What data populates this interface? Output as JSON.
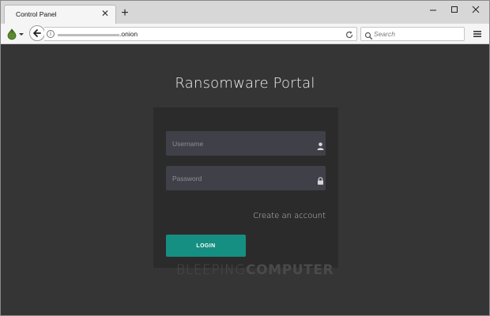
{
  "browser": {
    "tab": {
      "title": "Control Panel",
      "close_glyph": "✕"
    },
    "new_tab_glyph": "+",
    "url": {
      "visible_text": ".onion",
      "info_glyph": "i"
    },
    "search": {
      "placeholder": "Search"
    },
    "icons": {
      "onion": "onion-icon",
      "back": "back-arrow-icon",
      "reload": "reload-icon",
      "search": "search-icon",
      "menu": "hamburger-menu-icon",
      "minimize": "minimize-icon",
      "maximize": "maximize-icon",
      "close": "close-icon"
    }
  },
  "page": {
    "title": "Ransomware Portal",
    "form": {
      "username_placeholder": "Username",
      "password_placeholder": "Password",
      "create_account": "Create an account",
      "login_label": "LOGIN"
    },
    "watermark": {
      "part1": "BLEEPING",
      "part2": "COMPUTER"
    }
  },
  "colors": {
    "page_bg": "#353535",
    "card_bg": "#2b2b2b",
    "field_bg": "#404049",
    "login_button": "#168f83"
  }
}
